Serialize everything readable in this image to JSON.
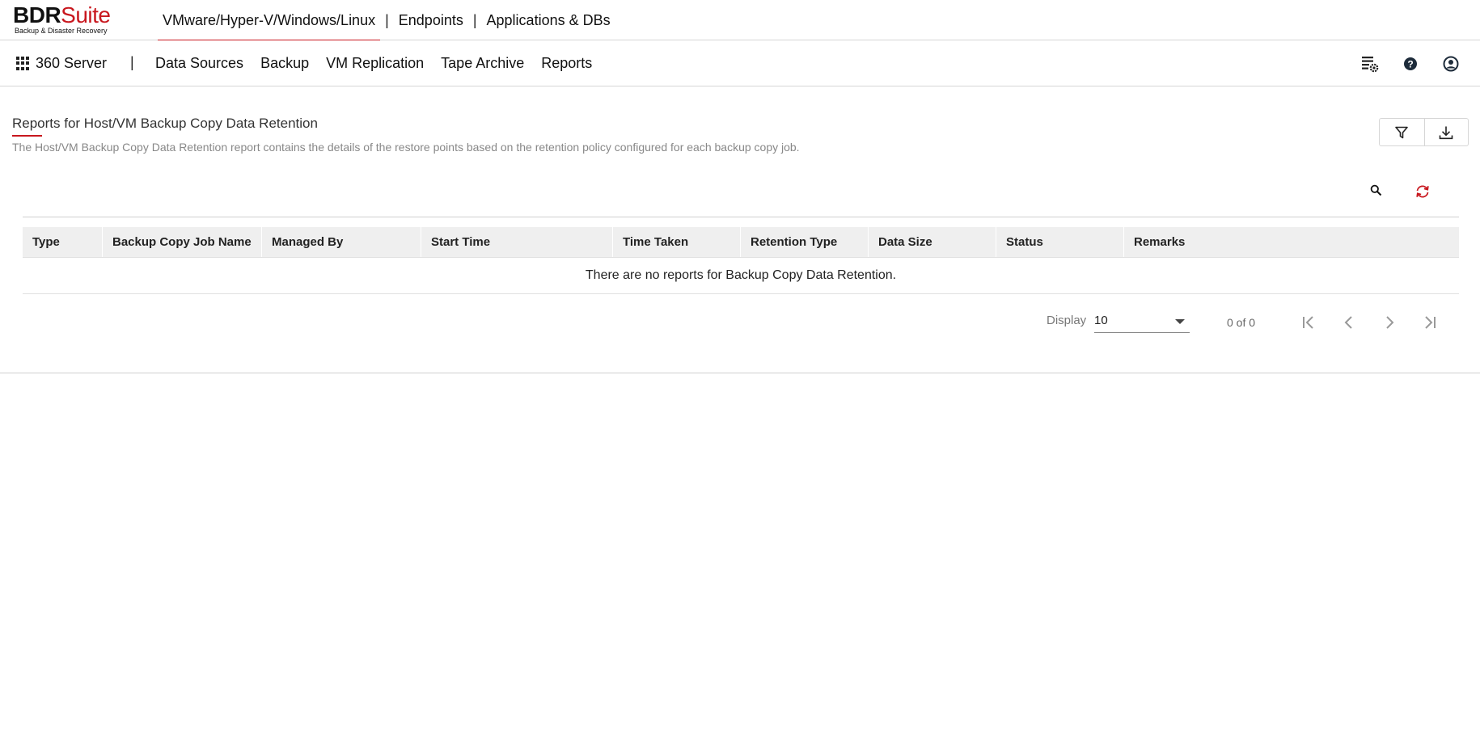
{
  "brand": {
    "name_part1": "BDR",
    "name_part2": "Suite",
    "tagline": "Backup & Disaster Recovery"
  },
  "top_nav": {
    "items": [
      {
        "label": "VMware/Hyper-V/Windows/Linux",
        "active": true
      },
      {
        "label": "Endpoints",
        "active": false
      },
      {
        "label": "Applications & DBs",
        "active": false
      }
    ],
    "separator": "|"
  },
  "secondary_nav": {
    "app_switcher_label": "360 Server",
    "separator": "|",
    "items": [
      "Data Sources",
      "Backup",
      "VM Replication",
      "Tape Archive",
      "Reports"
    ],
    "right_icons": [
      "server-settings-icon",
      "help-icon",
      "user-account-icon"
    ]
  },
  "page": {
    "title": "Reports for Host/VM Backup Copy Data Retention",
    "description": "The Host/VM Backup Copy Data Retention report contains the details of the restore points based on the retention policy configured for each backup copy job."
  },
  "actions": {
    "icons": [
      "filter-icon",
      "download-icon"
    ]
  },
  "toolbar": {
    "icons": [
      "search-icon",
      "refresh-icon"
    ]
  },
  "table": {
    "columns": [
      "Type",
      "Backup Copy Job Name",
      "Managed By",
      "Start Time",
      "Time Taken",
      "Retention Type",
      "Data Size",
      "Status",
      "Remarks"
    ],
    "empty_message": "There are no reports for Backup Copy Data Retention."
  },
  "pagination": {
    "display_label": "Display",
    "page_size": "10",
    "count_text": "0 of 0",
    "icons": [
      "first-page-icon",
      "prev-page-icon",
      "next-page-icon",
      "last-page-icon"
    ]
  },
  "colors": {
    "accent": "#c8171e",
    "header_bg": "#efefef",
    "border": "#d6d6d6"
  }
}
